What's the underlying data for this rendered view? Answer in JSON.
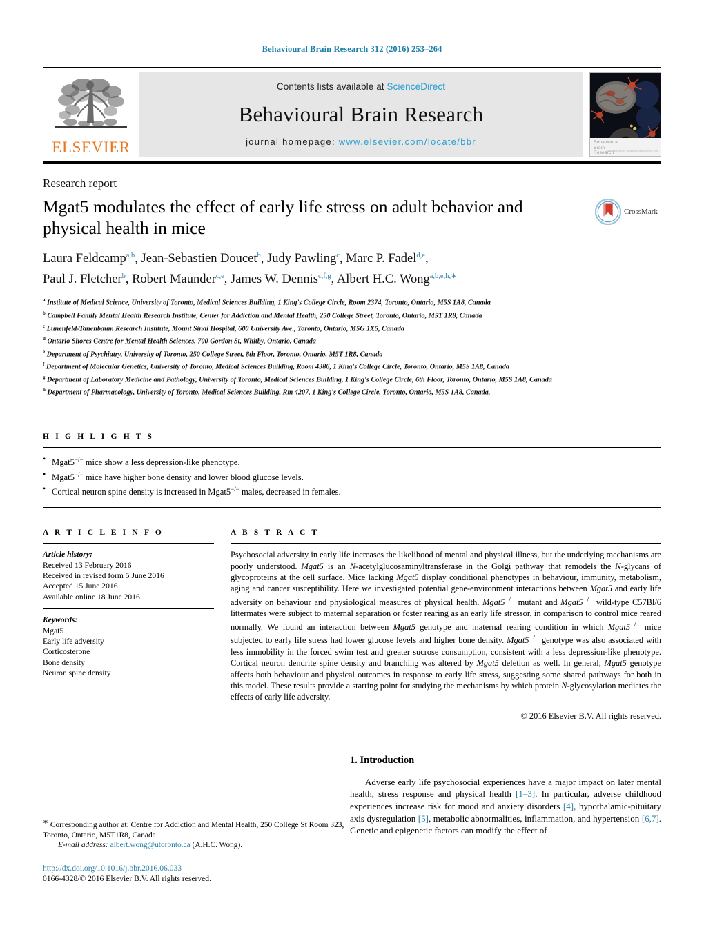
{
  "running_head": "Behavioural Brain Research 312 (2016) 253–264",
  "masthead": {
    "publisher_name": "ELSEVIER",
    "contents_prefix": "Contents lists available at",
    "sciencedirect": "ScienceDirect",
    "journal_title": "Behavioural Brain Research",
    "homepage_label": "journal homepage:",
    "homepage_url": "www.elsevier.com/locate/bbr",
    "cover_caption_line1": "Behavioural",
    "cover_caption_line2": "Brain",
    "cover_caption_line3": "Research",
    "cover_credit": "available online at www.sciencedirect.com"
  },
  "article": {
    "doctype": "Research report",
    "title": "Mgat5 modulates the effect of early life stress on adult behavior and physical health in mice",
    "crossmark_label": "CrossMark",
    "authors_line1_parts": [
      {
        "t": "Laura Feldcamp",
        "s": "a,b"
      },
      {
        "t": ", Jean-Sebastien Doucet",
        "s": "b"
      },
      {
        "t": ", Judy Pawling",
        "s": "c"
      },
      {
        "t": ", Marc P. Fadel",
        "s": "d,e"
      },
      {
        "t": ",",
        "s": ""
      }
    ],
    "authors_line2_parts": [
      {
        "t": "Paul J. Fletcher",
        "s": "b"
      },
      {
        "t": ", Robert Maunder",
        "s": "c,e"
      },
      {
        "t": ", James W. Dennis",
        "s": "c,f,g"
      },
      {
        "t": ", Albert H.C. Wong",
        "s": "a,b,e,h,∗"
      }
    ],
    "affiliations": [
      {
        "mark": "a",
        "text": "Institute of Medical Science, University of Toronto, Medical Sciences Building, 1 King's College Circle, Room 2374, Toronto, Ontario, M5S 1A8, Canada"
      },
      {
        "mark": "b",
        "text": "Campbell Family Mental Health Research Institute, Center for Addiction and Mental Health, 250 College Street, Toronto, Ontario, M5T 1R8, Canada"
      },
      {
        "mark": "c",
        "text": "Lunenfeld-Tanenbaum Research Institute, Mount Sinai Hospital, 600 University Ave., Toronto, Ontario, M5G 1X5, Canada"
      },
      {
        "mark": "d",
        "text": "Ontario Shores Centre for Mental Health Sciences, 700 Gordon St, Whitby, Ontario, Canada"
      },
      {
        "mark": "e",
        "text": "Department of Psychiatry, University of Toronto, 250 College Street, 8th Floor, Toronto, Ontario, M5T 1R8, Canada"
      },
      {
        "mark": "f",
        "text": "Department of Molecular Genetics, University of Toronto, Medical Sciences Building, Room 4386, 1 King's College Circle, Toronto, Ontario, M5S 1A8, Canada"
      },
      {
        "mark": "g",
        "text": "Department of Laboratory Medicine and Pathology, University of Toronto, Medical Sciences Building, 1 King's College Circle, 6th Floor, Toronto, Ontario, M5S 1A8, Canada"
      },
      {
        "mark": "h",
        "text": "Department of Pharmacology, University of Toronto, Medical Sciences Building, Rm 4207, 1 King's College Circle, Toronto, Ontario, M5S 1A8, Canada,"
      }
    ]
  },
  "highlights": {
    "heading": "H I G H L I G H T S",
    "items": [
      {
        "pre": "Mgat5",
        "sup": "−/−",
        "post": " mice show a less depression-like phenotype."
      },
      {
        "pre": "Mgat5",
        "sup": "−/−",
        "post": " mice have higher bone density and lower blood glucose levels."
      },
      {
        "pre": "Cortical neuron spine density is increased in Mgat5",
        "sup": "−/−",
        "post": " males, decreased in females."
      }
    ]
  },
  "article_info": {
    "heading": "A R T I C L E   I N F O",
    "history_label": "Article history:",
    "history": [
      "Received 13 February 2016",
      "Received in revised form 5 June 2016",
      "Accepted 15 June 2016",
      "Available online 18 June 2016"
    ],
    "keywords_label": "Keywords:",
    "keywords": [
      "Mgat5",
      "Early life adversity",
      "Corticosterone",
      "Bone density",
      "Neuron spine density"
    ]
  },
  "abstract": {
    "heading": "A B S T R A C T",
    "text_html": "Psychosocial adversity in early life increases the likelihood of mental and physical illness, but the underlying mechanisms are poorly understood. <i>Mgat5</i> is an <i>N</i>-acetylglucosaminyltransferase in the Golgi pathway that remodels the <i>N</i>-glycans of glycoproteins at the cell surface. Mice lacking <i>Mgat5</i> display conditional phenotypes in behaviour, immunity, metabolism, aging and cancer susceptibility. Here we investigated potential gene-environment interactions between <i>Mgat5</i> and early life adversity on behaviour and physiological measures of physical health. <i>Mgat5</i><sup>−/−</sup> mutant and <i>Mgat5</i><sup>+/+</sup> wild-type C57Bl/6 littermates were subject to maternal separation or foster rearing as an early life stressor, in comparison to control mice reared normally. We found an interaction between <i>Mgat5</i> genotype and maternal rearing condition in which <i>Mgat5</i><sup>−/−</sup> mice subjected to early life stress had lower glucose levels and higher bone density. <i>Mgat5</i><sup>−/−</sup> genotype was also associated with less immobility in the forced swim test and greater sucrose consumption, consistent with a less depression-like phenotype. Cortical neuron dendrite spine density and branching was altered by <i>Mgat5</i> deletion as well. In general, <i>Mgat5</i> genotype affects both behaviour and physical outcomes in response to early life stress, suggesting some shared pathways for both in this model. These results provide a starting point for studying the mechanisms by which protein <i>N</i>-glycosylation mediates the effects of early life adversity.",
    "copyright": "© 2016 Elsevier B.V. All rights reserved."
  },
  "introduction": {
    "heading": "1.  Introduction",
    "paragraph_html": "Adverse early life psychosocial experiences have a major impact on later mental health, stress response and physical health <span class=\"ref\">[1–3]</span>. In particular, adverse childhood experiences increase risk for mood and anxiety disorders <span class=\"ref\">[4]</span>, hypothalamic-pituitary axis dysregulation <span class=\"ref\">[5]</span>, metabolic abnormalities, inflammation, and hypertension <span class=\"ref\">[6,7]</span>. Genetic and epigenetic factors can modify the effect of"
  },
  "footnote": {
    "corresponding_html": "<sup>∗</sup> Corresponding author at: Centre for Addiction and Mental Health, 250 College St Room 323, Toronto, Ontario, M5T1R8, Canada.",
    "email_label": "E-mail address:",
    "email": "albert.wong@utoronto.ca",
    "email_owner": "(A.H.C. Wong).",
    "doi": "http://dx.doi.org/10.1016/j.bbr.2016.06.033",
    "issn_line": "0166-4328/© 2016 Elsevier B.V. All rights reserved."
  },
  "colors": {
    "link": "#2a80a8",
    "masthead_link": "#2a9fd0",
    "elsevier_orange": "#e87722",
    "masthead_bg": "#e6e6e6"
  }
}
